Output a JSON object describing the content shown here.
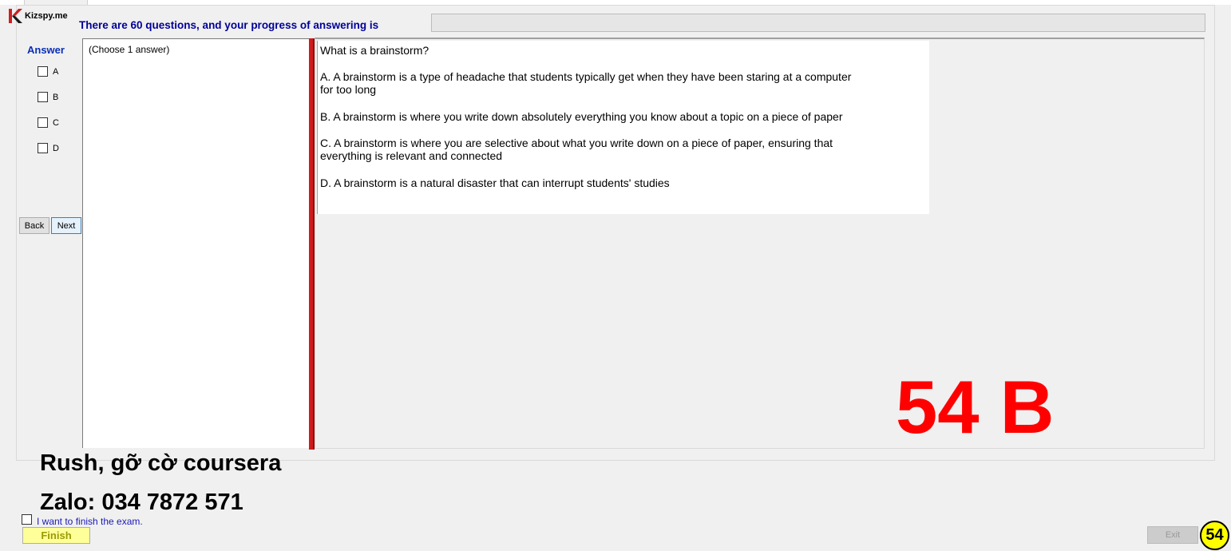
{
  "app": {
    "logo_text": "Kizspy.me",
    "header_text": "There are 60 questions, and your progress of answering is",
    "progress": 0
  },
  "answer_panel": {
    "title": "Answer",
    "options": [
      "A",
      "B",
      "C",
      "D"
    ],
    "back_label": "Back",
    "next_label": "Next"
  },
  "choose_hint": "(Choose 1 answer)",
  "question": {
    "lines": [
      "What is a brainstorm?",
      "A.  A brainstorm is a type of headache that students typically get when they have been staring at a computer",
      "for too long",
      "B.  A brainstorm is where you write down absolutely everything you know about a topic on a piece of paper",
      "C.  A brainstorm is where you are selective about what you write down on a piece of paper, ensuring that",
      "everything is relevant and connected",
      "D.  A brainstorm is a natural disaster that can interrupt students' studies"
    ]
  },
  "answer_stamp": "54 B",
  "overlay": {
    "line1": "Rush, gỡ cờ coursera",
    "line2": "Zalo: 034 7872 571"
  },
  "footer": {
    "finish_check_label": "I want to finish the exam.",
    "finish_label": "Finish",
    "exit_label": "Exit",
    "badge_number": "54"
  },
  "colors": {
    "header_text": "#000099",
    "splitter": "#d11a1a",
    "stamp": "#ff0000",
    "finish_bg": "#ffff99",
    "badge_bg": "#ffff00"
  }
}
